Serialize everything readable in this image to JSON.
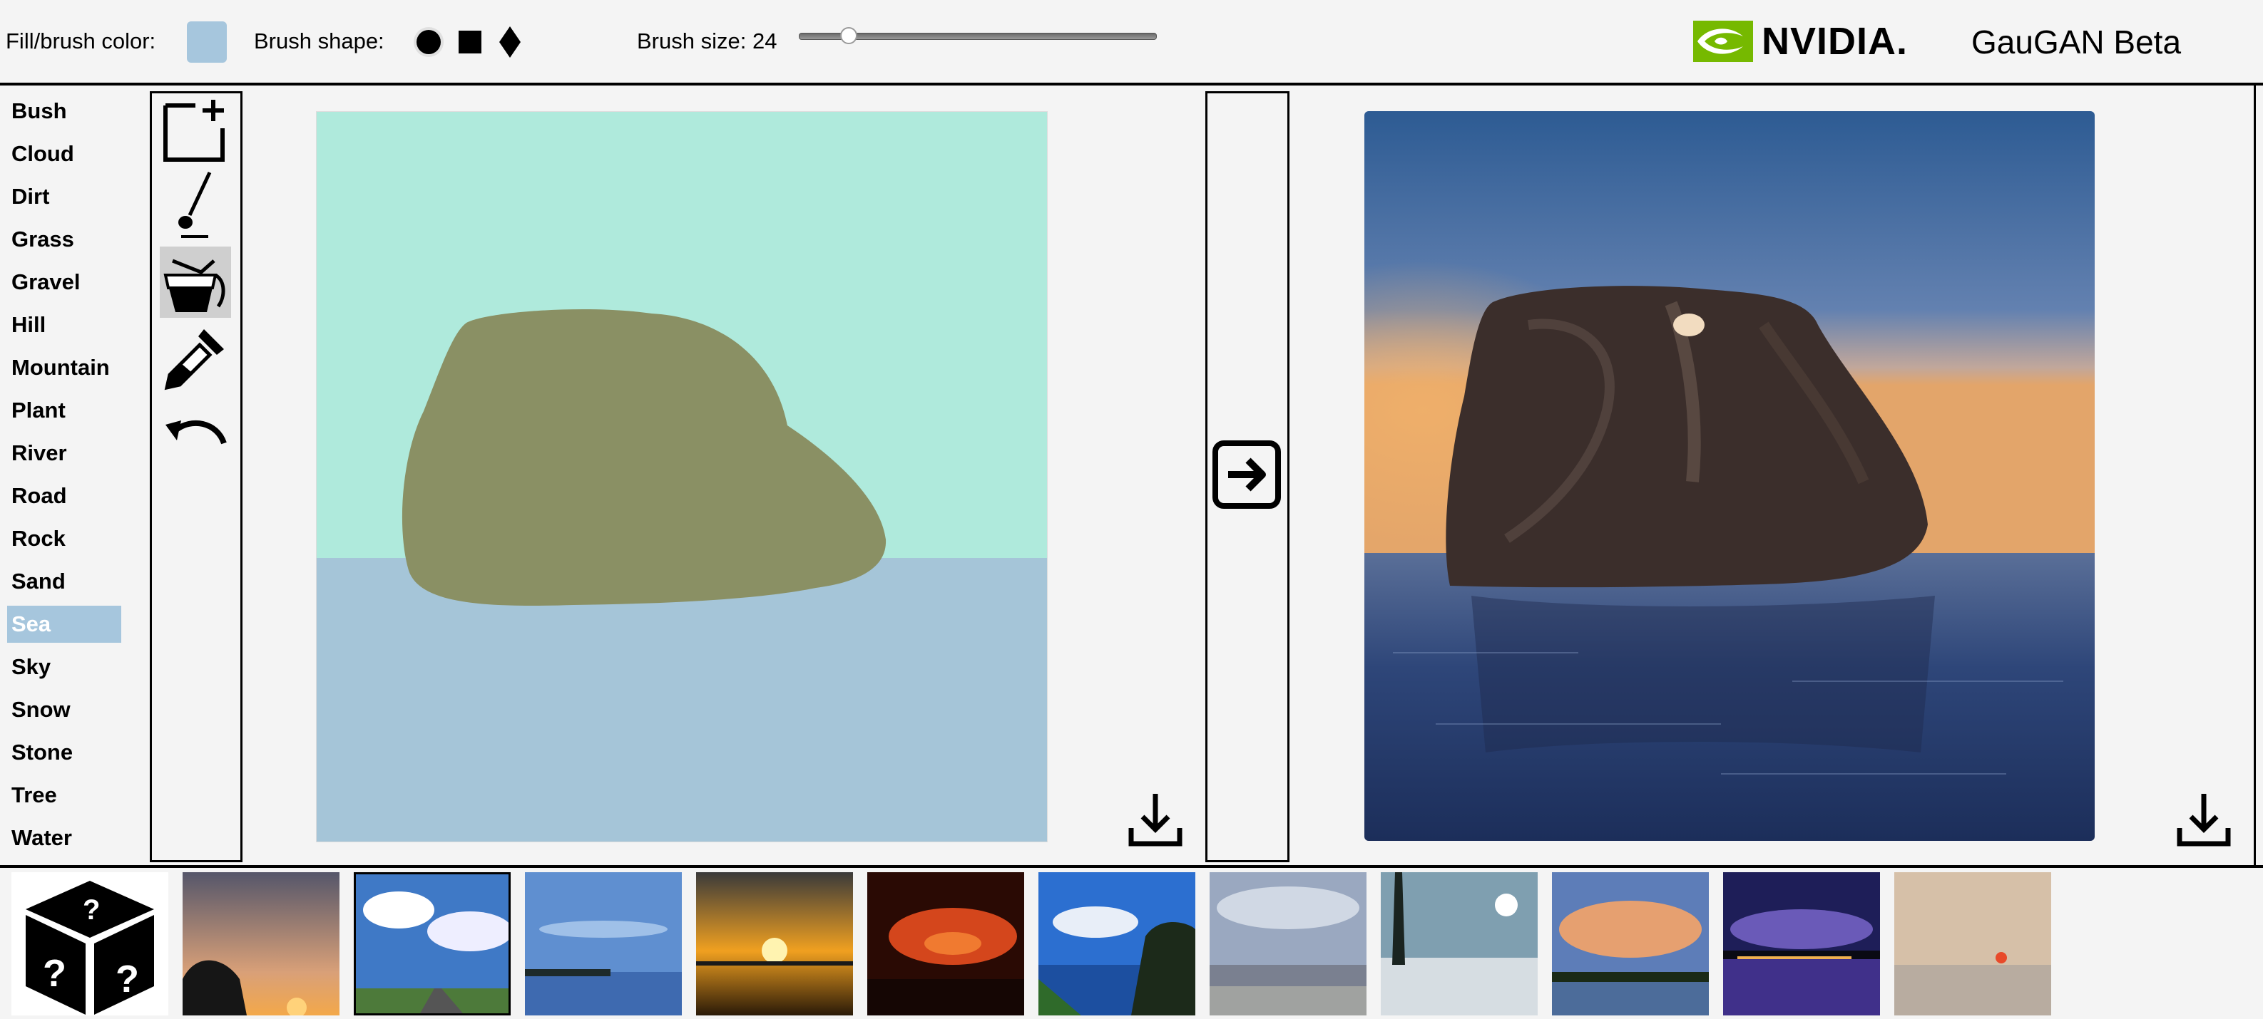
{
  "toolbar": {
    "fill_label": "Fill/brush color:",
    "fill_color": "#a6c6dd",
    "shape_label": "Brush shape:",
    "shapes": [
      "circle-brush-icon",
      "square-brush-icon",
      "diamond-brush-icon"
    ],
    "brush_size_label": "Brush size: 24",
    "brush_size_fraction": 0.14
  },
  "brand": {
    "logo_text": "NVIDIA.",
    "app_title": "GauGAN Beta",
    "accent": "#76b900"
  },
  "labels": {
    "items": [
      "Bush",
      "Cloud",
      "Dirt",
      "Grass",
      "Gravel",
      "Hill",
      "Mountain",
      "Plant",
      "River",
      "Road",
      "Rock",
      "Sand",
      "Sea",
      "Sky",
      "Snow",
      "Stone",
      "Tree",
      "Water"
    ],
    "selected": "Sea",
    "selected_color": "#a6c6dd"
  },
  "tools": [
    "new-canvas-icon",
    "brush-icon",
    "fill-bucket-icon",
    "eyedropper-icon",
    "undo-icon"
  ],
  "active_tool": "fill-bucket-icon",
  "segmentation_colors": {
    "sky": "#afeadc",
    "sea": "#a5c5d8",
    "rock": "#8a9064"
  },
  "thumbnails": [
    "random-dice-icon",
    "thumb-sunset-trees",
    "thumb-road-clouds",
    "thumb-lake-blue",
    "thumb-sunset-sea",
    "thumb-red-sunset",
    "thumb-coast-cliff",
    "thumb-cloudy-beach",
    "thumb-snowy-shore",
    "thumb-golden-clouds",
    "thumb-purple-lake",
    "thumb-misty-beach"
  ]
}
